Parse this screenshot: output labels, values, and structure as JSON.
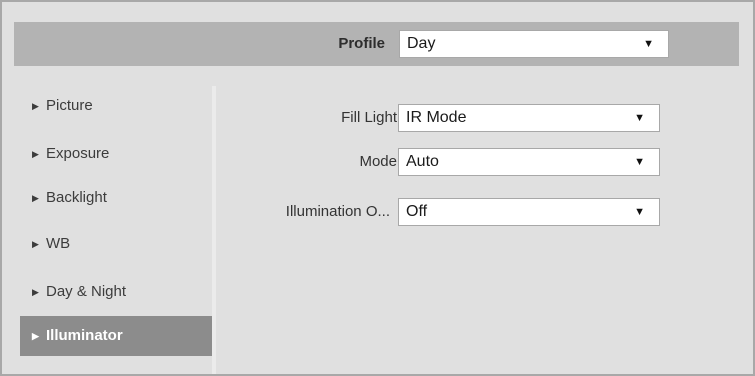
{
  "profile": {
    "label": "Profile",
    "value": "Day"
  },
  "sidebar": {
    "items": [
      {
        "label": "Picture"
      },
      {
        "label": "Exposure"
      },
      {
        "label": "Backlight"
      },
      {
        "label": "WB"
      },
      {
        "label": "Day & Night"
      },
      {
        "label": "Illuminator",
        "active": true
      }
    ]
  },
  "form": {
    "fill_light": {
      "label": "Fill Light",
      "value": "IR Mode"
    },
    "mode": {
      "label": "Mode",
      "value": "Auto"
    },
    "illumination": {
      "label": "Illumination O...",
      "value": "Off"
    }
  },
  "icons": {
    "dropdown": "triangle-down-icon",
    "collapse": "triangle-right-icon"
  },
  "colors": {
    "active_item_bg": "#8c8c8c",
    "panel_bg": "#e0e0e0",
    "profile_bar_bg": "#b3b3b3"
  }
}
